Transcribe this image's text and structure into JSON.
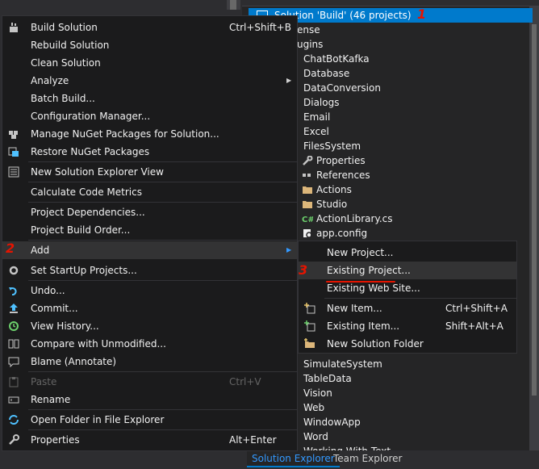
{
  "explorer": {
    "solution_label": "Solution 'Build' (46 projects)",
    "items": [
      {
        "label": "ense",
        "icon": "",
        "indent": 0
      },
      {
        "label": "ugins",
        "icon": "",
        "indent": 0
      },
      {
        "label": "ChatBotKafka",
        "icon": "",
        "indent": 1
      },
      {
        "label": "Database",
        "icon": "",
        "indent": 1
      },
      {
        "label": "DataConversion",
        "icon": "",
        "indent": 1
      },
      {
        "label": "Dialogs",
        "icon": "",
        "indent": 1
      },
      {
        "label": "Email",
        "icon": "",
        "indent": 1
      },
      {
        "label": "Excel",
        "icon": "",
        "indent": 1
      },
      {
        "label": "FilesSystem",
        "icon": "",
        "indent": 1
      },
      {
        "label": "Properties",
        "icon": "wrench-icon",
        "indent": 2
      },
      {
        "label": "References",
        "icon": "references-icon",
        "indent": 2
      },
      {
        "label": "Actions",
        "icon": "folder-icon",
        "indent": 2
      },
      {
        "label": "Studio",
        "icon": "folder-icon",
        "indent": 2
      },
      {
        "label": "ActionLibrary.cs",
        "icon": "csharp-icon",
        "indent": 2
      },
      {
        "label": "app.config",
        "icon": "config-icon",
        "indent": 2
      },
      {
        "label": "SimulateSystem",
        "icon": "",
        "indent": 1
      },
      {
        "label": "TableData",
        "icon": "",
        "indent": 1
      },
      {
        "label": "Vision",
        "icon": "",
        "indent": 1
      },
      {
        "label": "Web",
        "icon": "",
        "indent": 1
      },
      {
        "label": "WindowApp",
        "icon": "",
        "indent": 1
      },
      {
        "label": "Word",
        "icon": "",
        "indent": 1
      },
      {
        "label": "Working With Text",
        "icon": "",
        "indent": 1
      }
    ]
  },
  "annotations": {
    "one": "1",
    "two": "2",
    "three": "3"
  },
  "tabs": {
    "solution_explorer": "Solution Explorer",
    "team_explorer": "Team Explorer"
  },
  "menu": {
    "build_solution": {
      "label": "Build Solution",
      "shortcut": "Ctrl+Shift+B"
    },
    "rebuild_solution": "Rebuild Solution",
    "clean_solution": "Clean Solution",
    "analyze": "Analyze",
    "batch_build": "Batch Build...",
    "configuration_manager": "Configuration Manager...",
    "manage_nuget": "Manage NuGet Packages for Solution...",
    "restore_nuget": "Restore NuGet Packages",
    "new_solution_explorer_view": "New Solution Explorer View",
    "calculate_code_metrics": "Calculate Code Metrics",
    "project_dependencies": "Project Dependencies...",
    "project_build_order": "Project Build Order...",
    "add": "Add",
    "set_startup_projects": "Set StartUp Projects...",
    "undo": "Undo...",
    "commit": "Commit...",
    "view_history": "View History...",
    "compare_unmodified": "Compare with Unmodified...",
    "blame": "Blame (Annotate)",
    "paste": {
      "label": "Paste",
      "shortcut": "Ctrl+V"
    },
    "rename": "Rename",
    "open_folder": "Open Folder in File Explorer",
    "properties": {
      "label": "Properties",
      "shortcut": "Alt+Enter"
    }
  },
  "submenu": {
    "new_project": "New Project...",
    "existing_project": "Existing Project...",
    "existing_web_site": "Existing Web Site...",
    "new_item": {
      "label": "New Item...",
      "shortcut": "Ctrl+Shift+A"
    },
    "existing_item": {
      "label": "Existing Item...",
      "shortcut": "Shift+Alt+A"
    },
    "new_solution_folder": "New Solution Folder"
  },
  "colors": {
    "accent": "#007acc",
    "annotation": "#e51400",
    "menu_bg": "#1b1b1c",
    "highlight": "#333334"
  }
}
